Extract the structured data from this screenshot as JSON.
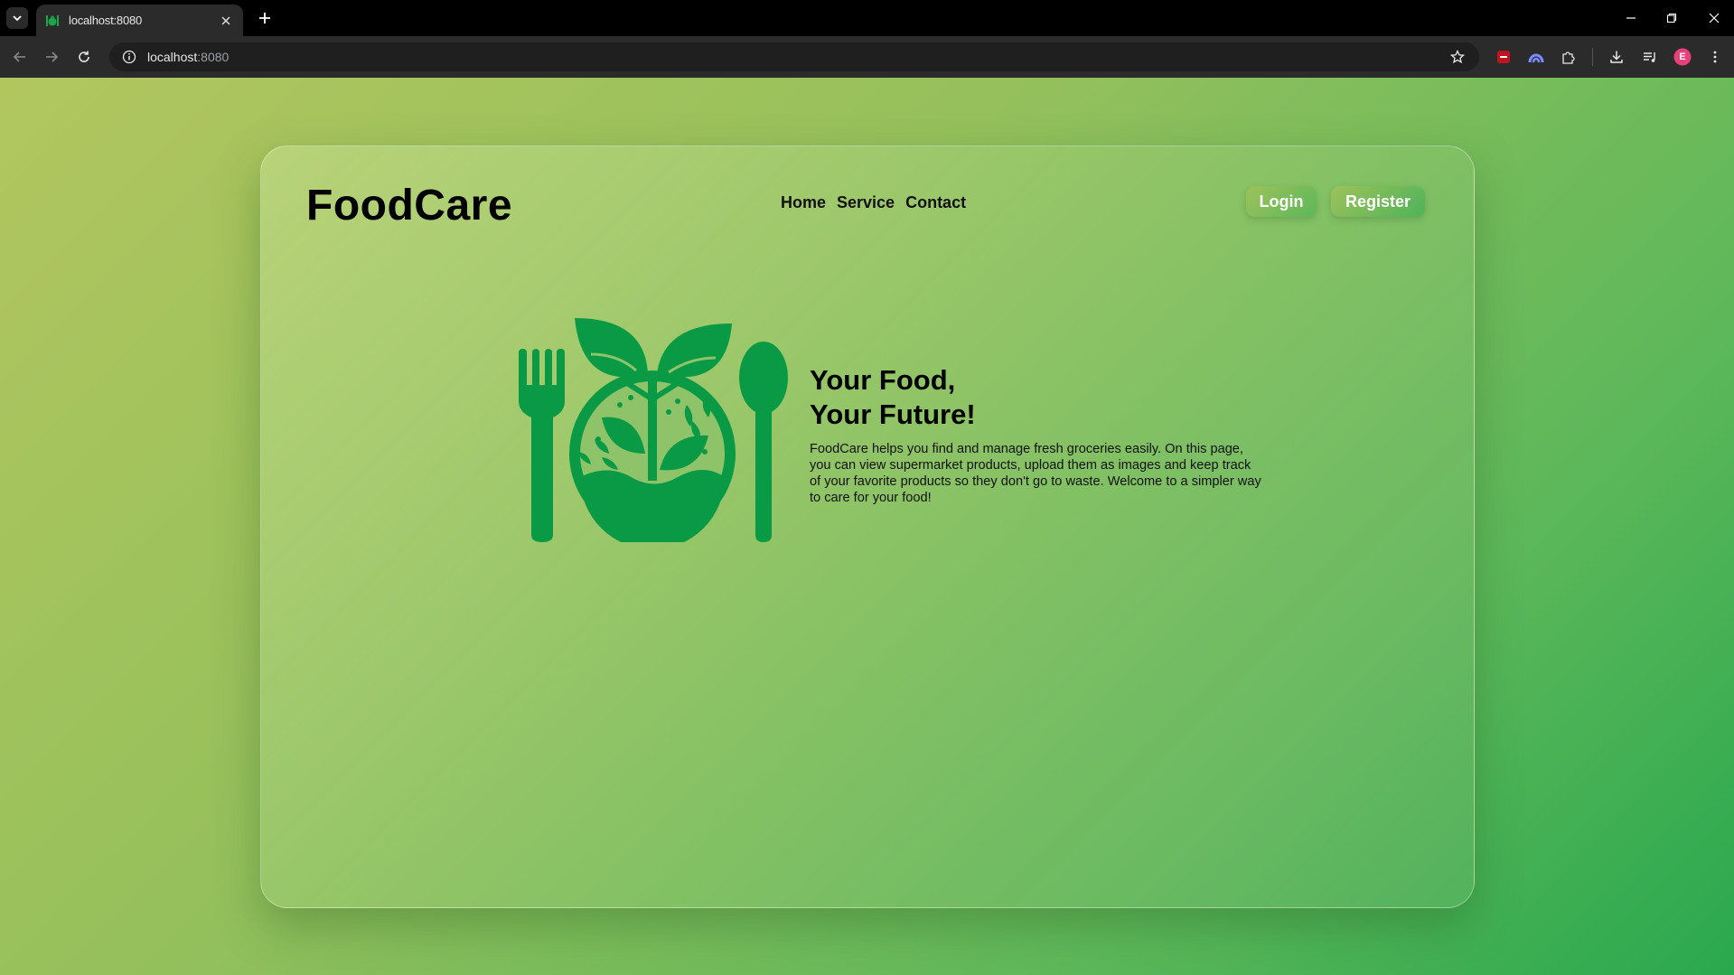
{
  "browser": {
    "tab_title": "localhost:8080",
    "url_host": "localhost",
    "url_port": ":8080",
    "profile_initial": "E",
    "profile_color": "#e8407a"
  },
  "header": {
    "brand": "FoodCare",
    "nav": [
      "Home",
      "Service",
      "Contact"
    ],
    "login_label": "Login",
    "register_label": "Register"
  },
  "hero": {
    "title_line1": "Your Food,",
    "title_line2": "Your Future!",
    "description": "FoodCare helps you find and manage fresh groceries easily. On this page, you can view supermarket products, upload them as images and keep track of your favorite products so they don't go to waste. Welcome to a simpler way to care for your food!"
  },
  "colors": {
    "brand_green": "#0a9a45",
    "accent_gradient_start": "#9dc25a",
    "accent_gradient_end": "#4eb35a"
  },
  "icons": [
    "tab-list-icon",
    "favicon-icon",
    "close-icon",
    "plus-icon",
    "back-icon",
    "forward-icon",
    "reload-icon",
    "site-info-icon",
    "star-icon",
    "extensions-icon",
    "download-icon",
    "media-icon",
    "menu-icon",
    "fork-icon",
    "spoon-icon",
    "leaf-icon"
  ]
}
